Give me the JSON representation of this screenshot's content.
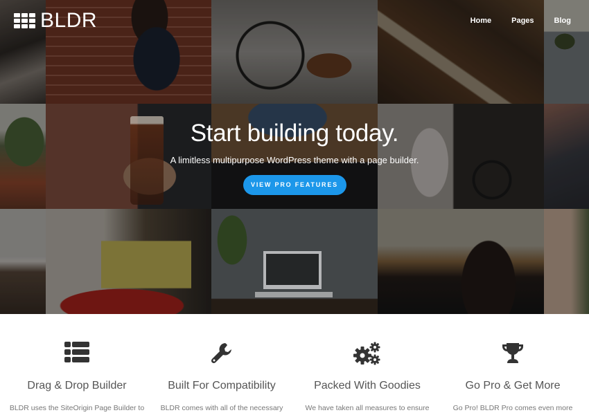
{
  "header": {
    "logo_text": "BLDR",
    "nav": [
      {
        "label": "Home"
      },
      {
        "label": "Pages"
      },
      {
        "label": "Blog"
      }
    ]
  },
  "hero": {
    "title": "Start building today.",
    "subtitle": "A limitless multipurpose WordPress theme with a page builder.",
    "cta_label": "VIEW PRO FEATURES",
    "cta_color": "#1c97ea"
  },
  "features": [
    {
      "icon": "list-icon",
      "title": "Drag & Drop Builder",
      "description": "BLDR uses the SiteOrigin Page Builder to"
    },
    {
      "icon": "wrench-icon",
      "title": "Built For Compatibility",
      "description": "BLDR comes with all of the necessary"
    },
    {
      "icon": "gears-icon",
      "title": "Packed With Goodies",
      "description": "We have taken all measures to ensure"
    },
    {
      "icon": "trophy-icon",
      "title": "Go Pro & Get More",
      "description": "Go Pro! BLDR Pro comes even more"
    }
  ]
}
